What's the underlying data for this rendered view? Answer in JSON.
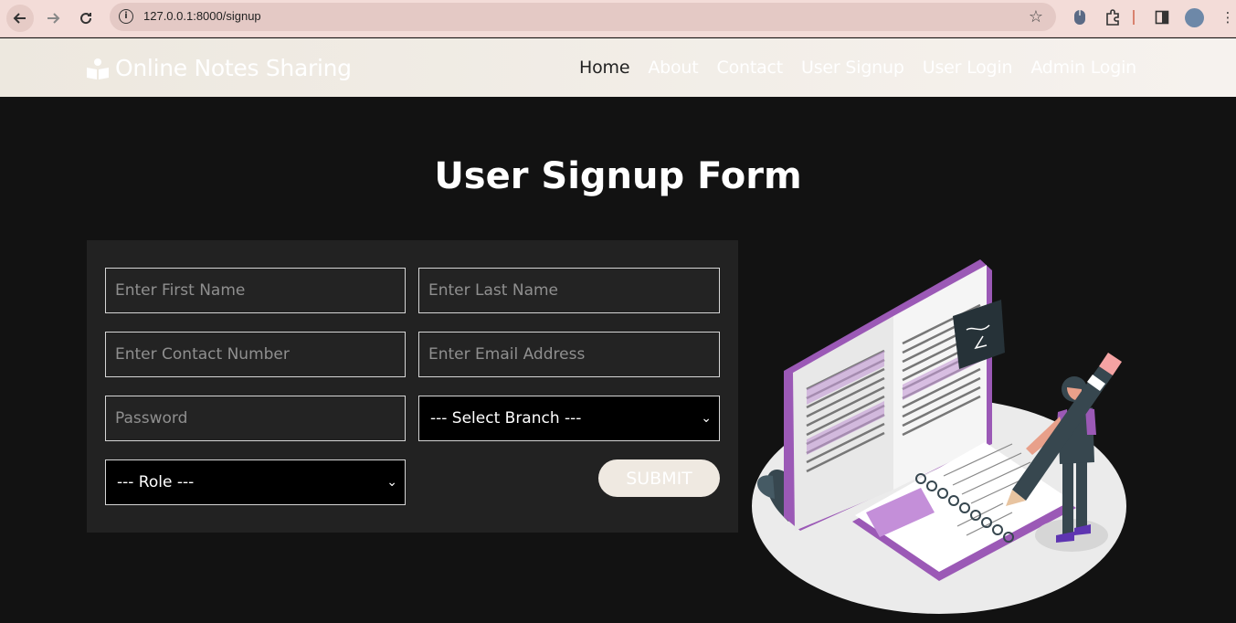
{
  "browser": {
    "url": "127.0.0.1:8000/signup",
    "url_host": "127.0.0.1",
    "url_rest": ":8000/signup"
  },
  "site": {
    "brand": "Online Notes Sharing",
    "nav": [
      {
        "label": "Home",
        "active": true
      },
      {
        "label": "About"
      },
      {
        "label": "Contact"
      },
      {
        "label": "User Signup"
      },
      {
        "label": "User Login"
      },
      {
        "label": "Admin Login"
      }
    ]
  },
  "page": {
    "title": "User Signup Form"
  },
  "form": {
    "first_name_placeholder": "Enter First Name",
    "last_name_placeholder": "Enter Last Name",
    "contact_placeholder": "Enter Contact Number",
    "email_placeholder": "Enter Email Address",
    "password_placeholder": "Password",
    "branch_selected": "--- Select Branch ---",
    "role_selected": "--- Role ---",
    "submit_label": "SUBMIT"
  },
  "colors": {
    "accent_purple": "#9b59b6",
    "page_bg": "#121212",
    "card_bg": "#222222"
  }
}
